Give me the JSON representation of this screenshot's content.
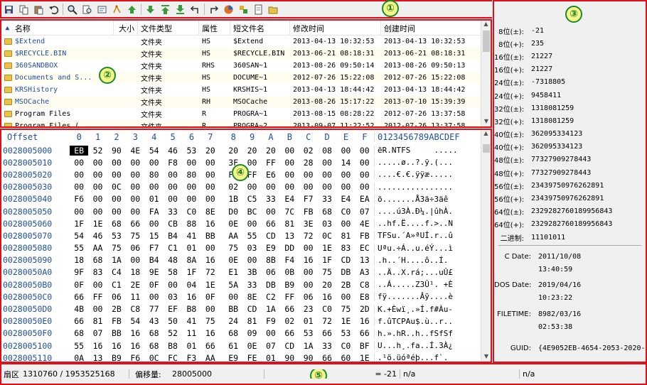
{
  "markers": {
    "toolbar": "①",
    "filelist": "②",
    "datainspector": "③",
    "hexview": "④",
    "statusbar": "⑤"
  },
  "toolbar": {
    "icons": [
      "save-icon",
      "copy-icon",
      "paste-icon",
      "undo-icon",
      "find-icon",
      "find-next-icon",
      "goto-icon",
      "jump-icon",
      "up-arrow-icon",
      "down-arrow-icon",
      "top-arrow-icon",
      "bottom-arrow-icon",
      "back-icon",
      "forward-icon",
      "color-icon",
      "swap-icon",
      "document-icon",
      "open-folder-icon"
    ]
  },
  "filelist": {
    "headers": {
      "name": "名称",
      "size": "大小",
      "type": "文件类型",
      "attr": "属性",
      "short": "短文件名",
      "mtime": "修改时间",
      "ctime": "创建时间"
    },
    "rows": [
      {
        "name": "$Extend",
        "size": "",
        "type": "文件夹",
        "attr": "HS",
        "short": "$Extend",
        "mtime": "2013-04-13 10:32:53",
        "ctime": "2013-04-13 10:32:53"
      },
      {
        "name": "$RECYCLE.BIN",
        "size": "",
        "type": "文件夹",
        "attr": "HS",
        "short": "$RECYCLE.BIN",
        "mtime": "2013-06-21 08:18:31",
        "ctime": "2013-06-21 08:18:31"
      },
      {
        "name": "360SANDBOX",
        "size": "",
        "type": "文件夹",
        "attr": "RHS",
        "short": "360SAN~1",
        "mtime": "2013-08-26 09:50:14",
        "ctime": "2013-08-26 09:50:13"
      },
      {
        "name": "Documents and S...",
        "size": "",
        "type": "文件夹",
        "attr": "HS",
        "short": "DOCUME~1",
        "mtime": "2012-07-26 15:22:08",
        "ctime": "2012-07-26 15:22:08"
      },
      {
        "name": "KRSHistory",
        "size": "",
        "type": "文件夹",
        "attr": "HS",
        "short": "KRSHIS~1",
        "mtime": "2013-04-13 18:44:42",
        "ctime": "2013-04-13 18:44:42"
      },
      {
        "name": "MSOCache",
        "size": "",
        "type": "文件夹",
        "attr": "RH",
        "short": "MSOCache",
        "mtime": "2013-08-26 15:17:22",
        "ctime": "2013-07-10 15:39:39"
      },
      {
        "name": "Program Files",
        "size": "",
        "type": "文件夹",
        "attr": "R",
        "short": "PROGRA~1",
        "mtime": "2013-08-15 08:28:22",
        "ctime": "2012-07-26 13:37:58"
      },
      {
        "name": "Program Files (",
        "size": "",
        "type": "文件夹",
        "attr": "R",
        "short": "PROGRA~2",
        "mtime": "2013-09-07 11:22:52",
        "ctime": "2012-07-26 13:37:58"
      }
    ]
  },
  "hexview": {
    "header_offset": "Offset",
    "header_cols": [
      "0",
      "1",
      "2",
      "3",
      "4",
      "5",
      "6",
      "7",
      "8",
      "9",
      "A",
      "B",
      "C",
      "D",
      "E",
      "F"
    ],
    "header_ascii": "0123456789ABCDEF",
    "rows": [
      {
        "off": "0028005000",
        "b": [
          "EB",
          "52",
          "90",
          "4E",
          "54",
          "46",
          "53",
          "20",
          "20",
          "20",
          "20",
          "00",
          "02",
          "08",
          "00",
          "00"
        ],
        "a": "ëR.NTFS     ....."
      },
      {
        "off": "0028005010",
        "b": [
          "00",
          "00",
          "00",
          "00",
          "00",
          "F8",
          "00",
          "00",
          "3F",
          "00",
          "FF",
          "00",
          "28",
          "00",
          "14",
          "00"
        ],
        "a": ".....ø..?.ÿ.(..."
      },
      {
        "off": "0028005020",
        "b": [
          "00",
          "00",
          "00",
          "00",
          "80",
          "00",
          "80",
          "00",
          "FF",
          "FF",
          "E6",
          "00",
          "00",
          "00",
          "00",
          "00"
        ],
        "a": "....€.€.ÿÿæ....."
      },
      {
        "off": "0028005030",
        "b": [
          "00",
          "00",
          "0C",
          "00",
          "00",
          "00",
          "00",
          "00",
          "02",
          "00",
          "00",
          "00",
          "00",
          "00",
          "00",
          "00"
        ],
        "a": "................"
      },
      {
        "off": "0028005040",
        "b": [
          "F6",
          "00",
          "00",
          "00",
          "01",
          "00",
          "00",
          "00",
          "1B",
          "C5",
          "33",
          "E4",
          "F7",
          "33",
          "E4",
          "EA"
        ],
        "a": "ö.......Å3ä÷3äê"
      },
      {
        "off": "0028005050",
        "b": [
          "00",
          "00",
          "00",
          "00",
          "FA",
          "33",
          "C0",
          "8E",
          "D0",
          "BC",
          "00",
          "7C",
          "FB",
          "68",
          "C0",
          "07"
        ],
        "a": "....ú3À.Ð¼.|ûhÀ."
      },
      {
        "off": "0028005060",
        "b": [
          "1F",
          "1E",
          "68",
          "66",
          "00",
          "CB",
          "88",
          "16",
          "0E",
          "00",
          "66",
          "81",
          "3E",
          "03",
          "00",
          "4E"
        ],
        "a": "..hf.Ë....f.>..N"
      },
      {
        "off": "0028005070",
        "b": [
          "54",
          "46",
          "53",
          "75",
          "15",
          "B4",
          "41",
          "BB",
          "AA",
          "55",
          "CD",
          "13",
          "72",
          "0C",
          "81",
          "FB"
        ],
        "a": "TFSu.´A»ªUÍ.r..û"
      },
      {
        "off": "0028005080",
        "b": [
          "55",
          "AA",
          "75",
          "06",
          "F7",
          "C1",
          "01",
          "00",
          "75",
          "03",
          "E9",
          "DD",
          "00",
          "1E",
          "83",
          "EC"
        ],
        "a": "Uªu.÷Á..u.éÝ...ì"
      },
      {
        "off": "0028005090",
        "b": [
          "18",
          "68",
          "1A",
          "00",
          "B4",
          "48",
          "8A",
          "16",
          "0E",
          "00",
          "8B",
          "F4",
          "16",
          "1F",
          "CD",
          "13"
        ],
        "a": ".h..´H....ô..Í."
      },
      {
        "off": "00280050A0",
        "b": [
          "9F",
          "83",
          "C4",
          "18",
          "9E",
          "58",
          "1F",
          "72",
          "E1",
          "3B",
          "06",
          "0B",
          "00",
          "75",
          "DB",
          "A3"
        ],
        "a": "..Ä..X.rá;...uÛ£"
      },
      {
        "off": "00280050B0",
        "b": [
          "0F",
          "00",
          "C1",
          "2E",
          "0F",
          "00",
          "04",
          "1E",
          "5A",
          "33",
          "DB",
          "B9",
          "00",
          "20",
          "2B",
          "C8"
        ],
        "a": "..Á.....Z3Û¹. +È"
      },
      {
        "off": "00280050C0",
        "b": [
          "66",
          "FF",
          "06",
          "11",
          "00",
          "03",
          "16",
          "0F",
          "00",
          "8E",
          "C2",
          "FF",
          "06",
          "16",
          "00",
          "E8"
        ],
        "a": "fÿ.......Âÿ....è"
      },
      {
        "off": "00280050D0",
        "b": [
          "4B",
          "00",
          "2B",
          "C8",
          "77",
          "EF",
          "B8",
          "00",
          "BB",
          "CD",
          "1A",
          "66",
          "23",
          "C0",
          "75",
          "2D"
        ],
        "a": "K.+Èwï¸.»Í.f#Àu-"
      },
      {
        "off": "00280050E0",
        "b": [
          "66",
          "81",
          "FB",
          "54",
          "43",
          "50",
          "41",
          "75",
          "24",
          "81",
          "F9",
          "02",
          "01",
          "72",
          "1E",
          "16"
        ],
        "a": "f.ûTCPAu$.ù..r.."
      },
      {
        "off": "00280050F0",
        "b": [
          "68",
          "07",
          "BB",
          "16",
          "68",
          "52",
          "11",
          "16",
          "68",
          "09",
          "00",
          "66",
          "53",
          "66",
          "53",
          "66"
        ],
        "a": "h.».hR..h..fSfSf"
      },
      {
        "off": "0028005100",
        "b": [
          "55",
          "16",
          "16",
          "16",
          "68",
          "B8",
          "01",
          "66",
          "61",
          "0E",
          "07",
          "CD",
          "1A",
          "33",
          "C0",
          "BF"
        ],
        "a": "U...h¸.fa..Í.3À¿"
      },
      {
        "off": "0028005110",
        "b": [
          "0A",
          "13",
          "B9",
          "F6",
          "0C",
          "FC",
          "F3",
          "AA",
          "E9",
          "FE",
          "01",
          "90",
          "90",
          "66",
          "60",
          "1E"
        ],
        "a": ".¹ö.üóªéþ...f`."
      }
    ]
  },
  "inspector": {
    "rows1": [
      {
        "l": "8位(±):",
        "v": "-21"
      },
      {
        "l": "8位(+):",
        "v": "235"
      },
      {
        "l": "16位(±):",
        "v": "21227"
      },
      {
        "l": "16位(+):",
        "v": "21227"
      },
      {
        "l": "24位(±):",
        "v": "-7318805"
      },
      {
        "l": "24位(+):",
        "v": "9458411"
      },
      {
        "l": "32位(±):",
        "v": "1318081259"
      },
      {
        "l": "32位(+):",
        "v": "1318081259"
      },
      {
        "l": "40位(±):",
        "v": "362095334123"
      },
      {
        "l": "40位(+):",
        "v": "362095334123"
      },
      {
        "l": "48位(±):",
        "v": "77327909278443"
      },
      {
        "l": "48位(+):",
        "v": "77327909278443"
      },
      {
        "l": "56位(±):",
        "v": "23439750976262891"
      },
      {
        "l": "56位(+):",
        "v": "23439750976262891"
      },
      {
        "l": "64位(±):",
        "v": "2329282760189956843"
      },
      {
        "l": "64位(+):",
        "v": "2329282760189956843"
      },
      {
        "l": "二进制:",
        "v": "11101011"
      }
    ],
    "cdate_label": "C Date:",
    "cdate": "2011/10/08",
    "ctime": "13:40:59",
    "dosdate_label": "DOS Date:",
    "dosdate": "2019/04/16",
    "dostime": "10:23:22",
    "filetime_label": "FILETIME:",
    "filetime_date": "8982/03/16",
    "filetime_time": "02:53:38",
    "guid_label": "GUID:",
    "guid": "{4E9052EB-4654-2053-2020-"
  },
  "statusbar": {
    "sector_label": "扇区",
    "sector_value": "1310760 / 1953525168",
    "offset_label": "偏移量:",
    "offset_value": "28005000",
    "value": "= -21",
    "na1": "n/a",
    "na2": "n/a"
  }
}
